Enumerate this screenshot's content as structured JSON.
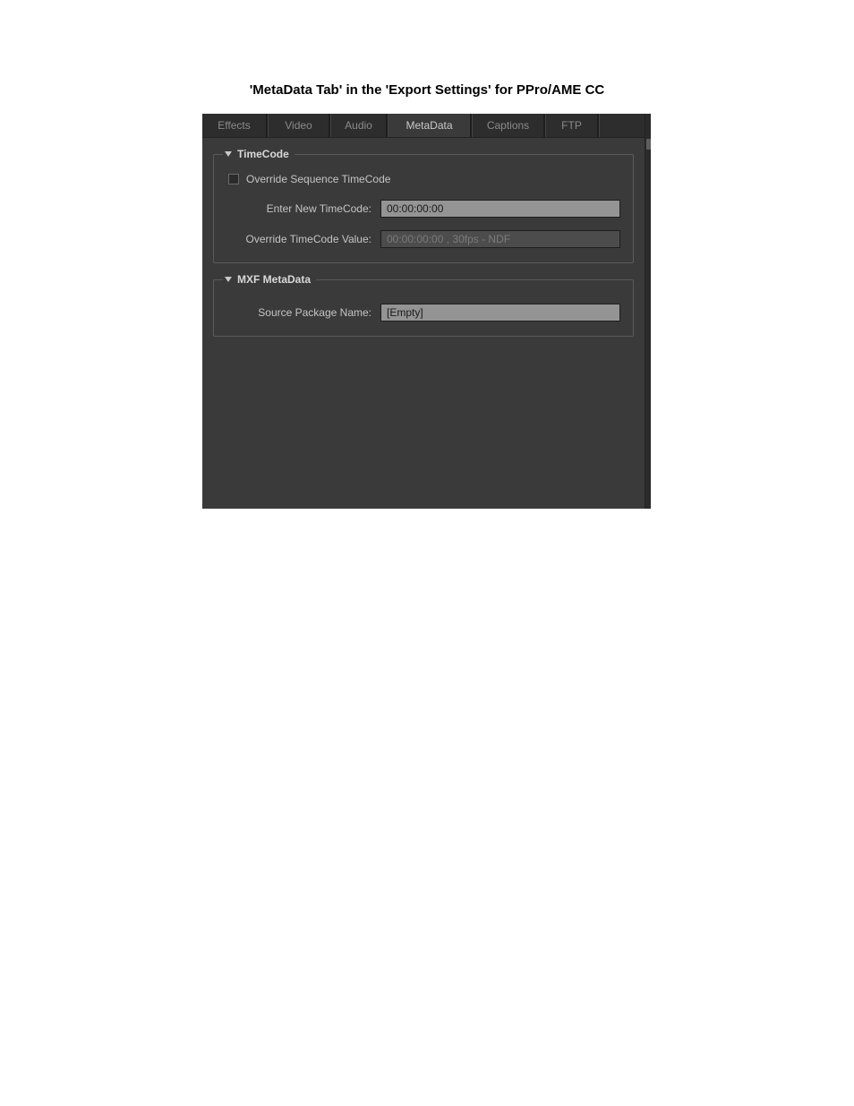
{
  "page": {
    "title": "'MetaData Tab' in the 'Export Settings' for PPro/AME CC"
  },
  "tabs": {
    "effects": "Effects",
    "video": "Video",
    "audio": "Audio",
    "metadata": "MetaData",
    "captions": "Captions",
    "ftp": "FTP"
  },
  "timecode": {
    "legend": "TimeCode",
    "override_sequence_label": "Override Sequence TimeCode",
    "enter_new_label": "Enter New TimeCode:",
    "enter_new_value": "00:00:00:00",
    "override_value_label": "Override TimeCode Value:",
    "override_value_value": "00:00:00:00 , 30fps - NDF"
  },
  "mxf": {
    "legend": "MXF MetaData",
    "source_package_label": "Source Package Name:",
    "source_package_value": "[Empty]"
  }
}
